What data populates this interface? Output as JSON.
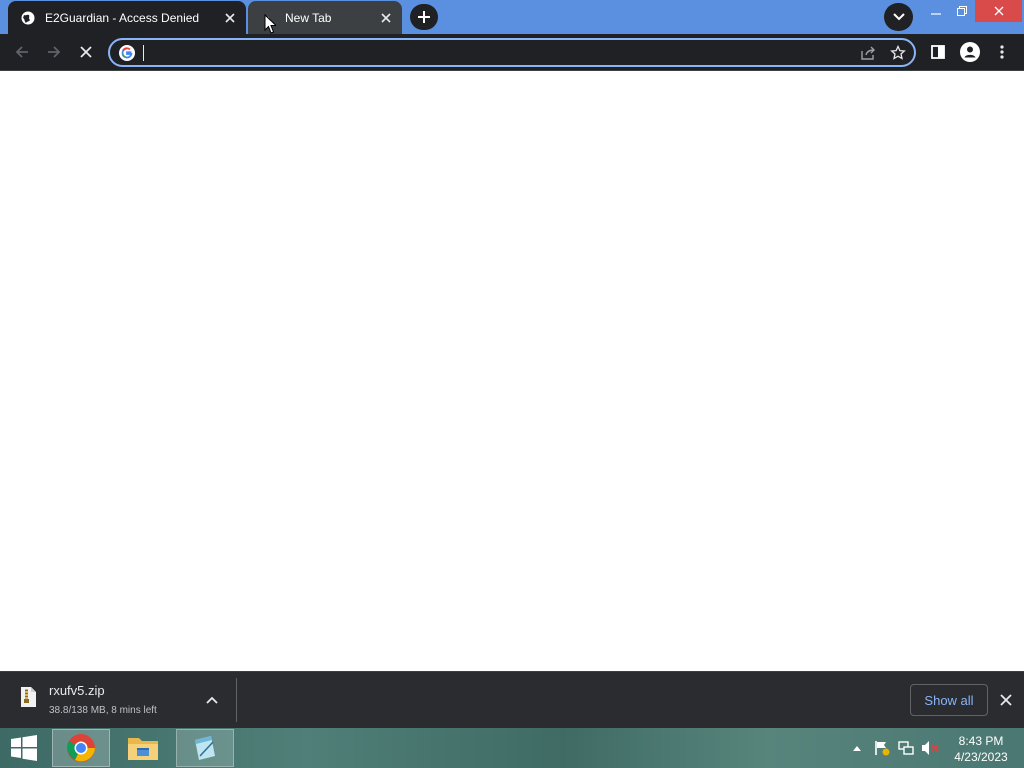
{
  "tabs": [
    {
      "title": "E2Guardian - Access Denied",
      "active": true,
      "favicon": "globe-icon"
    },
    {
      "title": "New Tab",
      "active": false,
      "favicon": "loading-icon"
    }
  ],
  "new_tab_icon": "plus-icon",
  "tab_search_icon": "chevron-down-icon",
  "window_controls": {
    "minimize": "minimize-icon",
    "restore": "restore-icon",
    "close": "close-icon"
  },
  "toolbar": {
    "back_icon": "arrow-left-icon",
    "forward_icon": "arrow-right-icon",
    "stop_icon": "close-icon",
    "omnibox": {
      "value": "",
      "placeholder": "",
      "engine_icon": "google-icon"
    },
    "share_icon": "share-icon",
    "bookmark_icon": "star-icon",
    "side_panel_icon": "side-panel-icon",
    "profile_icon": "profile-icon",
    "menu_icon": "kebab-menu-icon"
  },
  "download": {
    "filename": "rxufv5.zip",
    "status": "38.8/138 MB, 8 mins left",
    "file_icon": "zip-file-icon",
    "show_all_label": "Show all"
  },
  "taskbar": {
    "start_icon": "windows-logo-icon",
    "apps": [
      {
        "name": "Google Chrome",
        "icon": "chrome-icon",
        "active": true
      },
      {
        "name": "File Explorer",
        "icon": "folder-icon",
        "active": false
      },
      {
        "name": "Notepad",
        "icon": "notepad-icon",
        "active": true
      }
    ],
    "tray_icons": [
      "tray-overflow-icon",
      "action-center-flag-icon",
      "network-icon",
      "volume-muted-icon"
    ],
    "time": "8:43 PM",
    "date": "4/23/2023"
  },
  "colors": {
    "accent": "#8ab4f8",
    "titlebar": "#5b8fe0",
    "toolbar": "#202124",
    "close_red": "#d94a4a"
  }
}
